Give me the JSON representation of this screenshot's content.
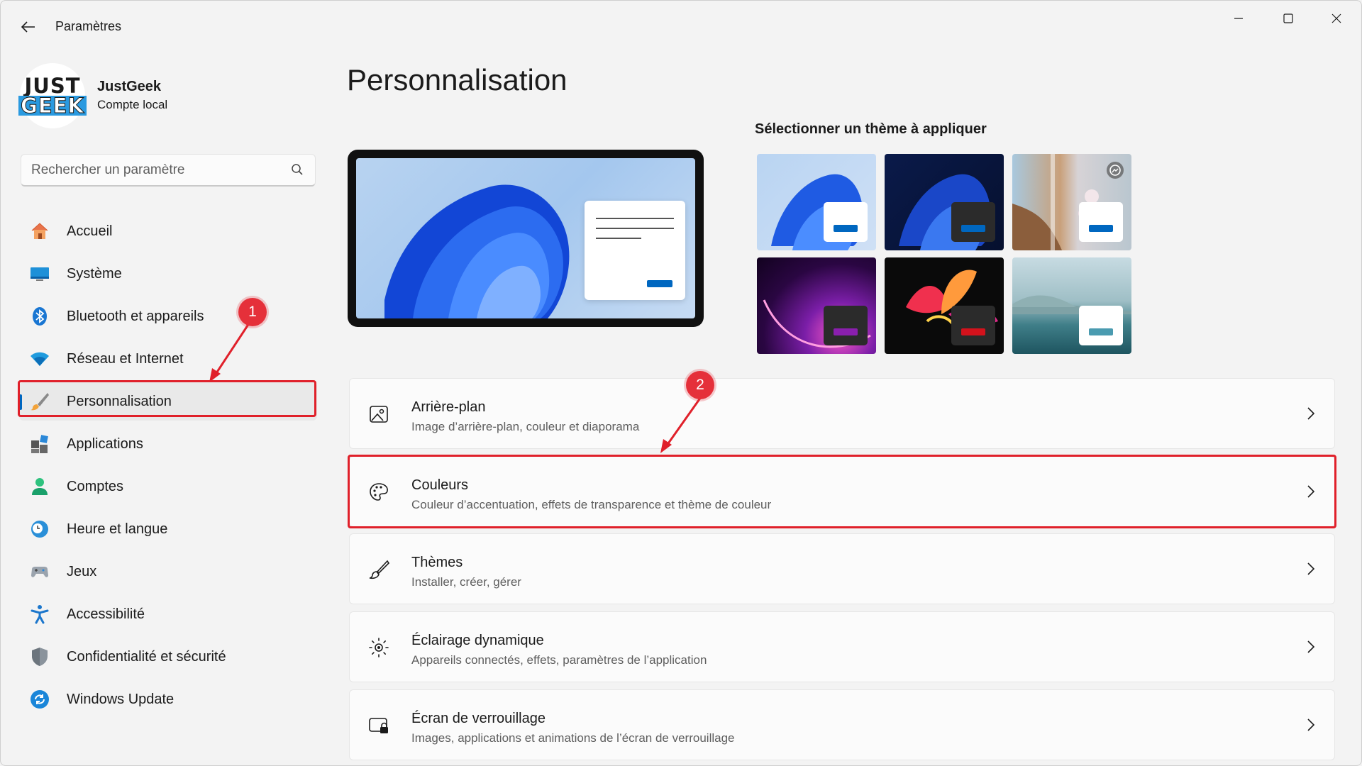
{
  "window": {
    "title": "Paramètres"
  },
  "profile": {
    "logo_line1": "JUST",
    "logo_line2": "GEEK",
    "name": "JustGeek",
    "account_type": "Compte local"
  },
  "search": {
    "placeholder": "Rechercher un paramètre"
  },
  "sidebar": {
    "items": [
      {
        "label": "Accueil",
        "icon": "home-icon"
      },
      {
        "label": "Système",
        "icon": "display-icon"
      },
      {
        "label": "Bluetooth et appareils",
        "icon": "bluetooth-icon"
      },
      {
        "label": "Réseau et Internet",
        "icon": "wifi-icon"
      },
      {
        "label": "Personnalisation",
        "icon": "brush-icon",
        "selected": true
      },
      {
        "label": "Applications",
        "icon": "apps-icon"
      },
      {
        "label": "Comptes",
        "icon": "user-icon"
      },
      {
        "label": "Heure et langue",
        "icon": "clock-globe-icon"
      },
      {
        "label": "Jeux",
        "icon": "gamepad-icon"
      },
      {
        "label": "Accessibilité",
        "icon": "accessibility-icon"
      },
      {
        "label": "Confidentialité et sécurité",
        "icon": "shield-icon"
      },
      {
        "label": "Windows Update",
        "icon": "update-icon"
      }
    ]
  },
  "annotations": {
    "badge1": "1",
    "badge2": "2",
    "color": "#e0202a"
  },
  "main": {
    "page_title": "Personnalisation",
    "themes_heading": "Sélectionner un thème à appliquer",
    "themes": [
      {
        "name": "windows-light-theme",
        "accent": "#0067c0"
      },
      {
        "name": "windows-dark-theme",
        "accent": "#0067c0"
      },
      {
        "name": "spotlight-theme",
        "accent": "#0067c0"
      },
      {
        "name": "glow-theme",
        "accent": "#8a1fae"
      },
      {
        "name": "captured-motion-theme",
        "accent": "#d3121c"
      },
      {
        "name": "flow-theme",
        "accent": "#4a9bb0"
      }
    ],
    "cards": [
      {
        "title": "Arrière-plan",
        "subtitle": "Image d’arrière-plan, couleur et diaporama",
        "icon": "image-icon"
      },
      {
        "title": "Couleurs",
        "subtitle": "Couleur d’accentuation, effets de transparence et thème de couleur",
        "icon": "palette-icon"
      },
      {
        "title": "Thèmes",
        "subtitle": "Installer, créer, gérer",
        "icon": "brush-icon"
      },
      {
        "title": "Éclairage dynamique",
        "subtitle": "Appareils connectés, effets, paramètres de l’application",
        "icon": "dynamic-lighting-icon"
      },
      {
        "title": "Écran de verrouillage",
        "subtitle": "Images, applications et animations de l’écran de verrouillage",
        "icon": "lock-screen-icon"
      }
    ]
  },
  "colors": {
    "accent": "#0067c0",
    "highlight": "#e0202a"
  }
}
